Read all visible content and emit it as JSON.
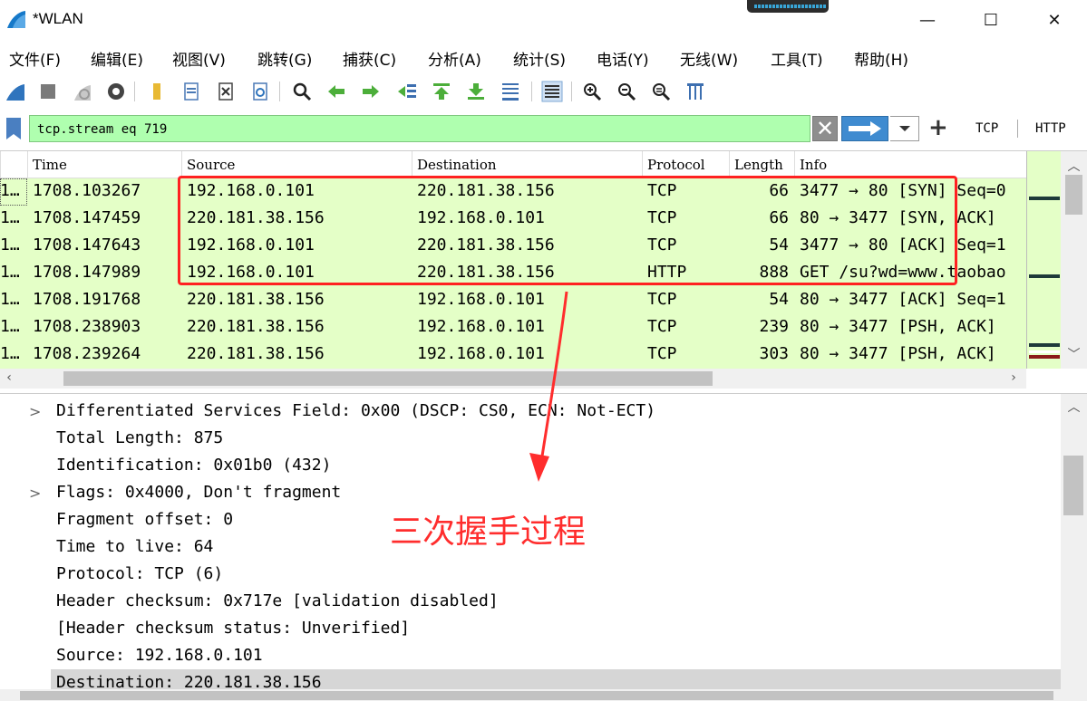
{
  "window": {
    "title": "*WLAN",
    "minimize": "—",
    "maximize": "☐",
    "close": "✕"
  },
  "menu": [
    "文件(F)",
    "编辑(E)",
    "视图(V)",
    "跳转(G)",
    "捕获(C)",
    "分析(A)",
    "统计(S)",
    "电话(Y)",
    "无线(W)",
    "工具(T)",
    "帮助(H)"
  ],
  "toolbar": {
    "icons": [
      "start-capture-icon",
      "stop-capture-icon",
      "restart-capture-icon",
      "capture-options-icon",
      "open-file-icon",
      "save-file-icon",
      "close-file-icon",
      "reload-file-icon",
      "find-packet-icon",
      "go-back-icon",
      "go-forward-icon",
      "go-to-packet-icon",
      "go-first-icon",
      "go-last-icon",
      "autoscroll-icon",
      "colorize-icon",
      "zoom-in-icon",
      "zoom-out-icon",
      "zoom-normal-icon",
      "resize-columns-icon"
    ]
  },
  "filter": {
    "value": "tcp.stream eq 719",
    "clear": "✕",
    "buttons": [
      "TCP",
      "HTTP"
    ],
    "add": "+"
  },
  "packet_list": {
    "columns": [
      "Time",
      "Source",
      "Destination",
      "Protocol",
      "Length",
      "Info"
    ],
    "rows": [
      {
        "no": "1…",
        "time": "1708.103267",
        "source": "192.168.0.101",
        "destination": "220.181.38.156",
        "protocol": "TCP",
        "length": "66",
        "info": "3477 → 80 [SYN] Seq=0"
      },
      {
        "no": "1…",
        "time": "1708.147459",
        "source": "220.181.38.156",
        "destination": "192.168.0.101",
        "protocol": "TCP",
        "length": "66",
        "info": "80 → 3477 [SYN, ACK]"
      },
      {
        "no": "1…",
        "time": "1708.147643",
        "source": "192.168.0.101",
        "destination": "220.181.38.156",
        "protocol": "TCP",
        "length": "54",
        "info": "3477 → 80 [ACK] Seq=1"
      },
      {
        "no": "1…",
        "time": "1708.147989",
        "source": "192.168.0.101",
        "destination": "220.181.38.156",
        "protocol": "HTTP",
        "length": "888",
        "info": "GET /su?wd=www.taobao"
      },
      {
        "no": "1…",
        "time": "1708.191768",
        "source": "220.181.38.156",
        "destination": "192.168.0.101",
        "protocol": "TCP",
        "length": "54",
        "info": "80 → 3477 [ACK] Seq=1"
      },
      {
        "no": "1…",
        "time": "1708.238903",
        "source": "220.181.38.156",
        "destination": "192.168.0.101",
        "protocol": "TCP",
        "length": "239",
        "info": "80 → 3477 [PSH, ACK]"
      },
      {
        "no": "1…",
        "time": "1708.239264",
        "source": "220.181.38.156",
        "destination": "192.168.0.101",
        "protocol": "TCP",
        "length": "303",
        "info": "80 → 3477 [PSH, ACK]"
      }
    ]
  },
  "annotation": {
    "text": "三次握手过程",
    "color": "#ff2d2d"
  },
  "details": {
    "lines": [
      {
        "text": "Differentiated Services Field: 0x00 (DSCP: CS0, ECN: Not-ECT)",
        "expandable": true
      },
      {
        "text": "Total Length: 875",
        "expandable": false
      },
      {
        "text": "Identification: 0x01b0 (432)",
        "expandable": false
      },
      {
        "text": "Flags: 0x4000, Don't fragment",
        "expandable": true
      },
      {
        "text": "Fragment offset: 0",
        "expandable": false
      },
      {
        "text": "Time to live: 64",
        "expandable": false
      },
      {
        "text": "Protocol: TCP (6)",
        "expandable": false
      },
      {
        "text": "Header checksum: 0x717e [validation disabled]",
        "expandable": false
      },
      {
        "text": "[Header checksum status: Unverified]",
        "expandable": false
      },
      {
        "text": "Source: 192.168.0.101",
        "expandable": false
      },
      {
        "text": "Destination: 220.181.38.156",
        "expandable": false
      }
    ]
  },
  "colors": {
    "row_bg": "#e4ffc7",
    "filter_bg": "#afffaf",
    "highlight": "#ff2121"
  }
}
